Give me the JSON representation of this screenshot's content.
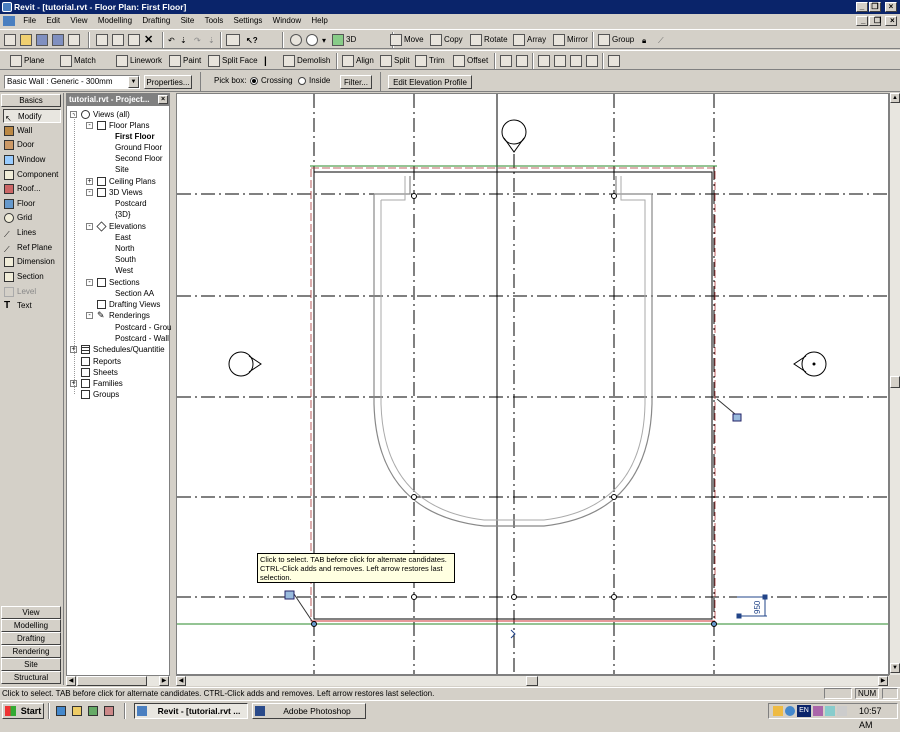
{
  "window": {
    "title": "Revit - [tutorial.rvt - Floor Plan: First Floor]"
  },
  "menu": [
    "File",
    "Edit",
    "View",
    "Modelling",
    "Drafting",
    "Site",
    "Tools",
    "Settings",
    "Window",
    "Help"
  ],
  "toolbar1": {
    "zoom_label": "3D",
    "move": "Move",
    "copy": "Copy",
    "rotate": "Rotate",
    "array": "Array",
    "mirror": "Mirror",
    "group": "Group"
  },
  "toolbar2": {
    "plane": "Plane",
    "match": "Match",
    "linework": "Linework",
    "paint": "Paint",
    "split_face": "Split Face",
    "demolish": "Demolish",
    "align": "Align",
    "split": "Split",
    "trim": "Trim",
    "offset": "Offset"
  },
  "options": {
    "type_selector": "Basic Wall : Generic - 300mm",
    "properties": "Properties...",
    "pick_box_label": "Pick box:",
    "crossing": "Crossing",
    "inside": "Inside",
    "filter": "Filter...",
    "edit_profile": "Edit Elevation Profile"
  },
  "design_bar": {
    "top_tab": "Basics",
    "items": [
      "Modify",
      "Wall",
      "Door",
      "Window",
      "Component",
      "Roof...",
      "Floor",
      "Grid",
      "Lines",
      "Ref Plane",
      "Dimension",
      "Section",
      "Level",
      "Text"
    ],
    "bottom_tabs": [
      "View",
      "Modelling",
      "Drafting",
      "Rendering",
      "Site",
      "Structural"
    ]
  },
  "browser": {
    "title": "tutorial.rvt - Project...",
    "nodes": [
      "Views (all)",
      "Floor Plans",
      "First Floor",
      "Ground Floor",
      "Second Floor",
      "Site",
      "Ceiling Plans",
      "3D Views",
      "Postcard",
      "{3D}",
      "Elevations",
      "East",
      "North",
      "South",
      "West",
      "Sections",
      "Section AA",
      "Drafting Views",
      "Renderings",
      "Postcard - Grou",
      "Postcard - Wall",
      "Schedules/Quantitie",
      "Reports",
      "Sheets",
      "Families",
      "Groups"
    ]
  },
  "canvas": {
    "dimension_label": "950"
  },
  "tooltip": {
    "line1": "Click to select. TAB before click for alternate candidates.",
    "line2": "CTRL-Click adds and removes. Left arrow restores last",
    "line3": "selection."
  },
  "status": {
    "message": "Click to select. TAB before click for alternate candidates. CTRL-Click adds and removes. Left arrow restores last selection.",
    "num": "NUM"
  },
  "taskbar": {
    "start": "Start",
    "tasks": [
      "Revit - [tutorial.rvt ...",
      "Adobe Photoshop"
    ],
    "lang": "EN",
    "clock": "10:57 AM"
  }
}
